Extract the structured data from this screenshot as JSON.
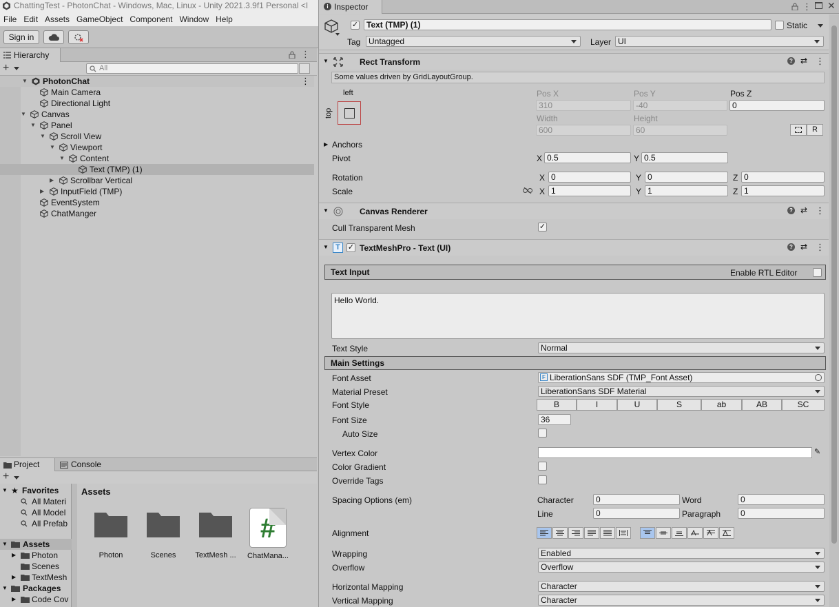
{
  "window": {
    "title": "ChattingTest - PhotonChat - Windows, Mac, Linux - Unity 2021.3.9f1 Personal <I"
  },
  "menu": [
    "File",
    "Edit",
    "Assets",
    "GameObject",
    "Component",
    "Window",
    "Help"
  ],
  "toolbar": {
    "sign_in": "Sign in"
  },
  "hierarchy": {
    "tab": "Hierarchy",
    "search_placeholder": "All",
    "scene": "PhotonChat",
    "items": [
      "Main Camera",
      "Directional Light",
      "Canvas",
      "Panel",
      "Scroll View",
      "Viewport",
      "Content",
      "Text (TMP) (1)",
      "Scrollbar Vertical",
      "InputField (TMP)",
      "EventSystem",
      "ChatManger"
    ]
  },
  "project": {
    "tabs": [
      "Project",
      "Console"
    ],
    "favorites": "Favorites",
    "fav_items": [
      "All Materi",
      "All Model",
      "All Prefab"
    ],
    "assets": "Assets",
    "asset_items": [
      "Photon",
      "Scenes",
      "TextMesh"
    ],
    "packages": "Packages",
    "package_items": [
      "Code Cov"
    ],
    "panel_title": "Assets",
    "grid": [
      "Photon",
      "Scenes",
      "TextMesh ...",
      "ChatMana..."
    ]
  },
  "inspector": {
    "tab": "Inspector",
    "object_name": "Text (TMP) (1)",
    "static_label": "Static",
    "tag_label": "Tag",
    "tag_value": "Untagged",
    "layer_label": "Layer",
    "layer_value": "UI",
    "rect": {
      "title": "Rect Transform",
      "note": "Some values driven by GridLayoutGroup.",
      "anchor_h": "left",
      "anchor_v": "top",
      "posx_label": "Pos X",
      "posx": "310",
      "posy_label": "Pos Y",
      "posy": "-40",
      "posz_label": "Pos Z",
      "posz": "0",
      "width_label": "Width",
      "width": "600",
      "height_label": "Height",
      "height": "60",
      "r_label": "R",
      "anchors": "Anchors",
      "pivot": "Pivot",
      "pivot_x": "0.5",
      "pivot_y": "0.5",
      "rotation": "Rotation",
      "rot_x": "0",
      "rot_y": "0",
      "rot_z": "0",
      "scale": "Scale",
      "scale_x": "1",
      "scale_y": "1",
      "scale_z": "1",
      "x": "X",
      "y": "Y",
      "z": "Z"
    },
    "canvas_renderer": {
      "title": "Canvas Renderer",
      "cull": "Cull Transparent Mesh"
    },
    "tmp": {
      "title": "TextMeshPro - Text (UI)",
      "text_input": "Text Input",
      "rtl": "Enable RTL Editor",
      "text": "Hello World.",
      "text_style_label": "Text Style",
      "text_style": "Normal",
      "main_settings": "Main Settings",
      "font_asset_label": "Font Asset",
      "font_asset": "LiberationSans SDF (TMP_Font Asset)",
      "material_preset_label": "Material Preset",
      "material_preset": "LiberationSans SDF Material",
      "font_style_label": "Font Style",
      "font_styles": [
        "B",
        "I",
        "U",
        "S",
        "ab",
        "AB",
        "SC"
      ],
      "font_size_label": "Font Size",
      "font_size": "36",
      "auto_size": "Auto Size",
      "vertex_color": "Vertex Color",
      "color_gradient": "Color Gradient",
      "override_tags": "Override Tags",
      "spacing_label": "Spacing Options (em)",
      "character_label": "Character",
      "character": "0",
      "word_label": "Word",
      "word": "0",
      "line_label": "Line",
      "line": "0",
      "paragraph_label": "Paragraph",
      "paragraph": "0",
      "alignment": "Alignment",
      "wrapping_label": "Wrapping",
      "wrapping": "Enabled",
      "overflow_label": "Overflow",
      "overflow": "Overflow",
      "hmap_label": "Horizontal Mapping",
      "hmap": "Character",
      "vmap_label": "Vertical Mapping",
      "vmap": "Character"
    }
  }
}
